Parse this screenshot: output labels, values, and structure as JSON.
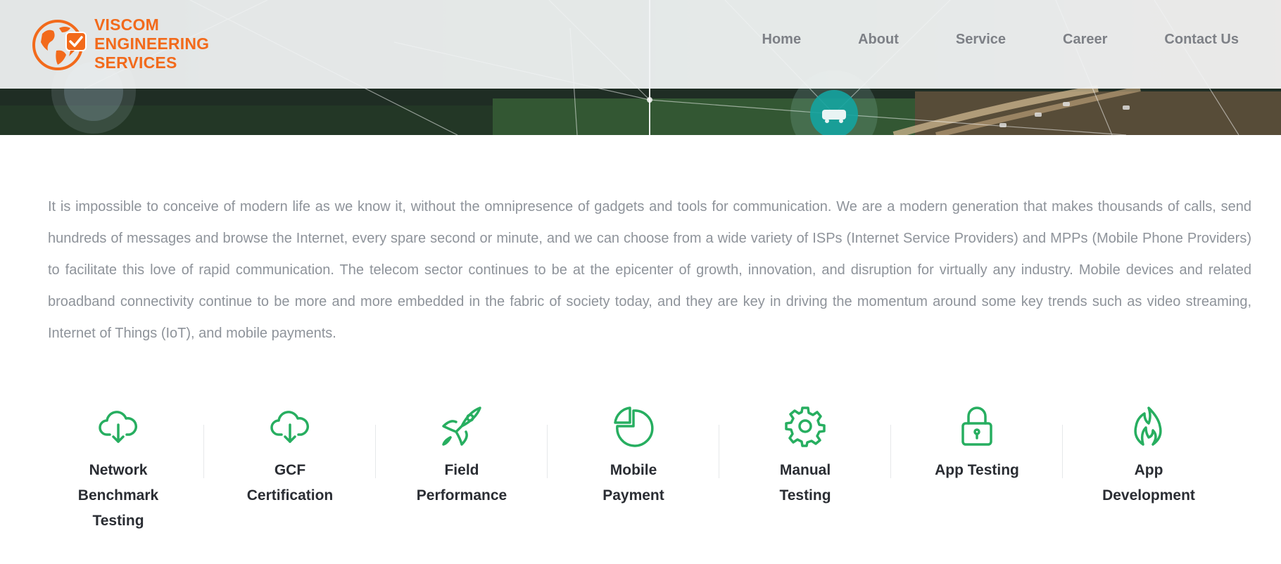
{
  "brand": {
    "name_lines": [
      "VISCOM",
      "ENGINEERING",
      "SERVICES"
    ],
    "logo_color": "#f26a1b",
    "icon": "globe-chat-check-icon"
  },
  "nav": {
    "items": [
      {
        "label": "Home"
      },
      {
        "label": "About"
      },
      {
        "label": "Service"
      },
      {
        "label": "Career"
      },
      {
        "label": "Contact Us"
      }
    ]
  },
  "intro": {
    "text": "It is impossible to conceive of modern life as we know it, without the omnipresence of gadgets and tools for communication. We are a modern generation that makes thousands of calls, send hundreds of messages and browse the Internet, every spare second or minute, and we can choose from a wide variety of ISPs (Internet Service Providers) and MPPs (Mobile Phone Providers) to facilitate this love of rapid communication. The telecom sector continues to be at the epicenter of growth, innovation, and disruption for virtually any industry. Mobile devices and related broadband connectivity continue to be more and more embedded in the fabric of society today, and they are key in driving the momentum around some key trends such as video streaming, Internet of Things (IoT), and mobile payments."
  },
  "services": {
    "accent_color": "#27ae60",
    "items": [
      {
        "label": "Network Benchmark Testing",
        "icon": "cloud-download-icon"
      },
      {
        "label": "GCF Certification",
        "icon": "cloud-download-icon"
      },
      {
        "label": "Field Performance",
        "icon": "rocket-icon"
      },
      {
        "label": "Mobile Payment",
        "icon": "pie-chart-icon"
      },
      {
        "label": "Manual Testing",
        "icon": "gear-icon"
      },
      {
        "label": "App Testing",
        "icon": "lock-icon"
      },
      {
        "label": "App Development",
        "icon": "flame-icon"
      }
    ]
  }
}
